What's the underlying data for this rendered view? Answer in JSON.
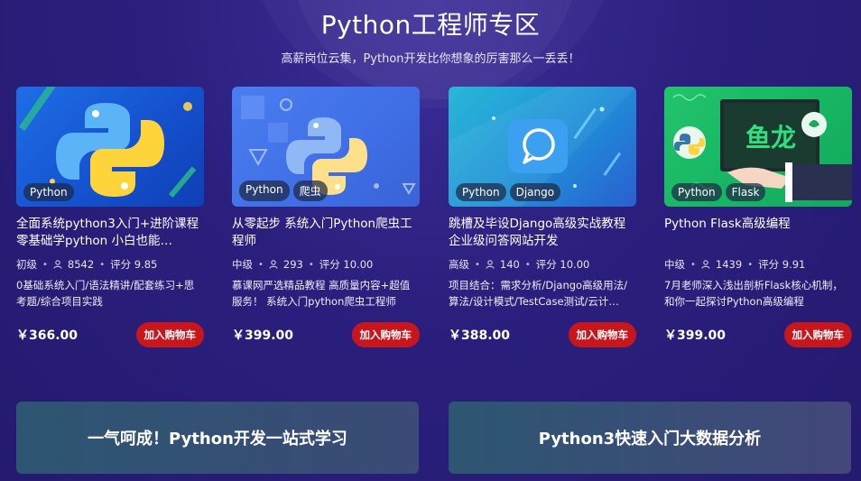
{
  "header": {
    "title": "Python工程师专区",
    "subtitle": "高薪岗位云集，Python开发比你想象的厉害那么一丢丢！"
  },
  "courses": [
    {
      "tags": [
        "Python"
      ],
      "title": "全面系统python3入门+进阶课程 零基础学python 小白也能…",
      "level": "初级",
      "students": "8542",
      "rating": "评分 9.85",
      "desc": "0基础系统入门/语法精讲/配套练习+思考题/综合项目实践",
      "price": "￥366.00",
      "cart_label": "加入购物车"
    },
    {
      "tags": [
        "Python",
        "爬虫"
      ],
      "title": "从零起步 系统入门Python爬虫工程师",
      "level": "中级",
      "students": "293",
      "rating": "评分 10.00",
      "desc": "慕课网严选精品教程 高质量内容+超值服务！ 系统入门python爬虫工程师",
      "price": "￥399.00",
      "cart_label": "加入购物车"
    },
    {
      "tags": [
        "Python",
        "Django"
      ],
      "title": "跳槽及毕设Django高级实战教程 企业级问答网站开发",
      "level": "高级",
      "students": "140",
      "rating": "评分 10.00",
      "desc": "项目结合：需求分析/Django高级用法/算法/设计模式/TestCase测试/云计…",
      "price": "￥388.00",
      "cart_label": "加入购物车"
    },
    {
      "tags": [
        "Python",
        "Flask"
      ],
      "title": "Python Flask高级编程",
      "level": "中级",
      "students": "1439",
      "rating": "评分 9.91",
      "desc": "7月老师深入浅出剖析Flask核心机制，和你一起探讨Python高级编程",
      "price": "￥399.00",
      "cart_label": "加入购物车"
    }
  ],
  "banners": [
    {
      "label": "一气呵成！Python开发一站式学习"
    },
    {
      "label": "Python3快速入门大数据分析"
    }
  ],
  "colors": {
    "background": "#2b1f7e",
    "cart_button": "#c8161d",
    "banner": "#2d5672"
  },
  "icons": {
    "students": "user-icon",
    "thumbs": [
      "python-logo-icon",
      "python-logo-icon",
      "chat-bubble-icon",
      "flask-calligraphy-icon"
    ]
  }
}
